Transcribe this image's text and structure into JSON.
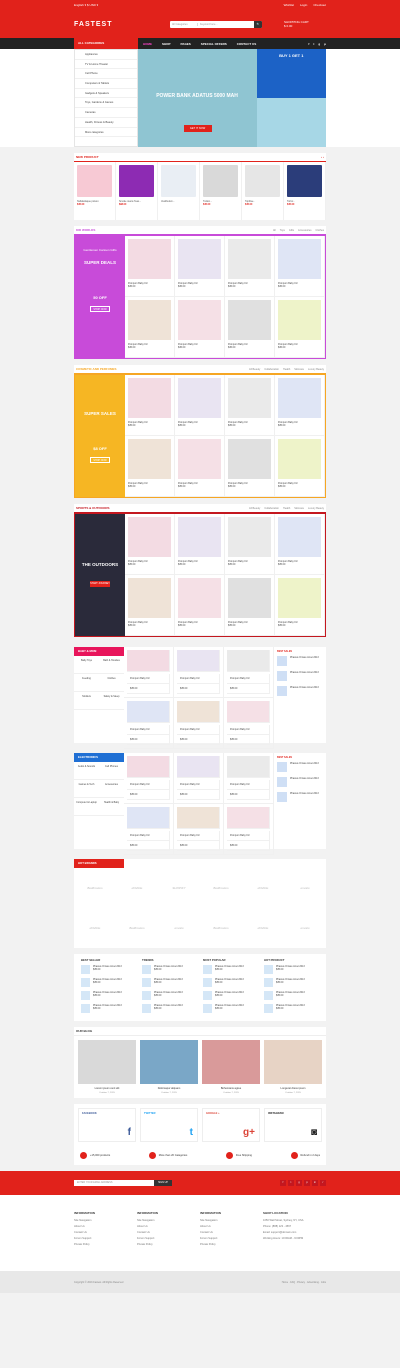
{
  "top": {
    "left": "English ▾  $ USD ▾",
    "wishlist": "Wishlist",
    "login": "Login",
    "checkout": "Checkout"
  },
  "header": {
    "logo": "FASTEST",
    "search_cat": "All Categories",
    "search_ph": "Keyword here...",
    "search_btn": "🔍",
    "cart": "SHOPPING CART",
    "cart_val": "$ 0.00"
  },
  "nav": {
    "allcat": "ALL CATEGORIES",
    "items": [
      "HOME",
      "SHOP",
      "PAGES",
      "SPECIAL OFFERS",
      "CONTACT US"
    ]
  },
  "cats": [
    "Appliances",
    "TV & Home Theater",
    "Cell Phone",
    "Computers & Tablets",
    "Gadgets & Speakers",
    "Toys, Gardens & Games",
    "Cameras",
    "Health, Fitness & Beauty",
    "More categories"
  ],
  "slider": {
    "title": "POWER BANK ADATUS 5000 MAH",
    "btn": "GET IT NOW"
  },
  "sidebanner": {
    "title": "BUY 1 GET 1"
  },
  "newprod": {
    "title": "NEW PRODUCT",
    "items": [
      {
        "name": "Nullafeilaque poison",
        "price": "$45.00"
      },
      {
        "name": "Smoke Jeans Teas...",
        "price": "$98.00"
      },
      {
        "name": "Vestibulum...",
        "price": ""
      },
      {
        "name": "Tuition...",
        "price": "$45.00"
      },
      {
        "name": "Topblue..",
        "price": "$45.00"
      },
      {
        "name": "Tortor...",
        "price": "$45.00"
      }
    ]
  },
  "kids": {
    "title": "KID WORLDS",
    "tabs": [
      "All",
      "Toys",
      "Gifts",
      "Accessories",
      "Clothes"
    ],
    "promo_small": "Gentlemen Cartoon Gifts",
    "promo_big": "SUPER DEALS",
    "promo_off": "50 OFF",
    "promo_btn": "SHOP NOW",
    "items": [
      {
        "name": "Pompom Baby Kiz",
        "price": "$45.00"
      },
      {
        "name": "Pompom Baby Kiz",
        "price": "$45.00"
      },
      {
        "name": "Pompom Baby Kiz",
        "price": "$45.00"
      },
      {
        "name": "Pompom Baby Kiz",
        "price": "$45.00"
      },
      {
        "name": "Pompom Baby Kiz",
        "price": "$45.00"
      },
      {
        "name": "Pompom Baby Kiz",
        "price": "$45.00"
      },
      {
        "name": "Pompom Baby Kiz",
        "price": "$45.00"
      },
      {
        "name": "Pompom Baby Kiz",
        "price": "$45.00"
      }
    ]
  },
  "cosmetic": {
    "title": "COSMETIC AND PERFUMES",
    "tabs": [
      "All Beauty",
      "Collaboration",
      "Health",
      "Skincare",
      "Luxury Beauty"
    ],
    "promo_big": "SUPER SALES",
    "promo_off": "$8 OFF",
    "promo_btn": "SHOP NOW",
    "items": [
      {
        "name": "Pompom Baby Kiz",
        "price": "$35.00"
      },
      {
        "name": "Pompom Baby Kiz",
        "price": "$35.00"
      },
      {
        "name": "Pompom Baby Kiz",
        "price": "$35.00"
      },
      {
        "name": "Pompom Baby Kiz",
        "price": "$35.00"
      },
      {
        "name": "Pompom Baby Kiz",
        "price": "$35.00"
      },
      {
        "name": "Pompom Baby Kiz",
        "price": "$35.00"
      },
      {
        "name": "Pompom Baby Kiz",
        "price": "$35.00"
      },
      {
        "name": "Pompom Baby Kiz",
        "price": "$35.00"
      }
    ]
  },
  "sports": {
    "title": "SPORTS & OUTDOORS",
    "tabs": [
      "All Beauty",
      "Collaboration",
      "Health",
      "Skincare",
      "Luxury Beauty"
    ],
    "promo_big": "THE OUTDOORS",
    "promo_btn": "START JOURNEY",
    "items": [
      {
        "name": "Pompom Baby Kiz",
        "price": "$35.00"
      },
      {
        "name": "Pompom Baby Kiz",
        "price": "$35.00"
      },
      {
        "name": "Pompom Baby Kiz",
        "price": "$35.00"
      },
      {
        "name": "Pompom Baby Kiz",
        "price": "$35.00"
      },
      {
        "name": "Pompom Baby Kiz",
        "price": "$35.00"
      },
      {
        "name": "Pompom Baby Kiz",
        "price": "$35.00"
      },
      {
        "name": "Pompom Baby Kiz",
        "price": "$35.00"
      },
      {
        "name": "Pompom Baby Kiz",
        "price": "$35.00"
      }
    ]
  },
  "baby": {
    "title": "BABY & MOM",
    "cats": [
      "Baby Toys",
      "Bath & Hoodies",
      "Feeding",
      "Clothes",
      "Strollers",
      "Safety & Sleep"
    ],
    "best": "BEST SALES",
    "items": [
      "Pompom Baby Kiz",
      "Pompom Baby Kiz",
      "Pompom Baby Kiz",
      "Pompom Baby Kiz",
      "Pompom Baby Kiz",
      "Pompom Baby Kiz"
    ],
    "price": "$35.00",
    "bestitems": [
      "Phasius Ornare Amet 2013",
      "Phasius Ornare Amet 2013",
      "Phasius Ornare Amet 2013"
    ]
  },
  "electronics": {
    "title": "ELECTRONICS",
    "cats": [
      "Audio & Sounds",
      "Cell Phones",
      "Games & Tech",
      "Accessories",
      "Computer & Laptop",
      "Health & Baby"
    ],
    "best": "BEST SALES",
    "items": [
      "Pompom Baby Kiz",
      "Pompom Baby Kiz",
      "Pompom Baby Kiz",
      "Pompom Baby Kiz",
      "Pompom Baby Kiz",
      "Pompom Baby Kiz"
    ],
    "price": "$35.00",
    "bestitems": [
      "Phasius Ornare Amet 2013",
      "Phasius Ornare Amet 2013",
      "Phasius Ornare Amet 2013"
    ]
  },
  "brands": {
    "title": "HOT BRANDS",
    "items": [
      "Bedfrosters",
      "dribbble",
      "SHOPIFY",
      "Bedfrosters",
      "dribbble",
      "envato",
      "dribbble",
      "Bedfrosters",
      "envato",
      "Bedfrosters",
      "dribbble",
      "envato"
    ]
  },
  "lists": {
    "cols": [
      {
        "h": "BEST SELLER"
      },
      {
        "h": "TRENDS"
      },
      {
        "h": "MOST POPULAR"
      },
      {
        "h": "HOT PRODUCT"
      }
    ],
    "item": "Phasius Ornare Amet 2013",
    "price": "$35.00"
  },
  "blog": {
    "title": "OUR BLOG",
    "posts": [
      {
        "t": "Lorem ipsum ount elit",
        "d": "October 7, 2015"
      },
      {
        "t": "Dolorsapur aliquam",
        "d": "October 7, 2015"
      },
      {
        "t": "Bohemians agree",
        "d": "October 7, 2015"
      },
      {
        "t": "Longerat dress ipsum",
        "d": "October 7, 2015"
      }
    ]
  },
  "social": [
    {
      "t": "FACEBOOK",
      "i": "f"
    },
    {
      "t": "TWITTER",
      "i": "t"
    },
    {
      "t": "GOOGLE +",
      "i": "g+"
    },
    {
      "t": "INSTAGRAM",
      "i": "◙"
    }
  ],
  "features": [
    "+15,000 products",
    "More than 20 Categories",
    "Free Shipping",
    "Refund in 2 days"
  ],
  "newsletter": {
    "ph": "ENTER YOUR EMAIL ADDRESS",
    "btn": "SIGN UP",
    "soc": [
      "f",
      "t",
      "g",
      "p",
      "in",
      "r"
    ]
  },
  "footer": [
    {
      "h": "INFORMATION",
      "items": [
        "Site Navigation",
        "About Us",
        "Contact Us",
        "Forum Support",
        "Private Policy"
      ]
    },
    {
      "h": "INFORMATION",
      "items": [
        "Site Navigation",
        "About Us",
        "Contact Us",
        "Forum Support",
        "Private Policy"
      ]
    },
    {
      "h": "INFORMATION",
      "items": [
        "Site Navigation",
        "About Us",
        "Contact Us",
        "Forum Support",
        "Private Policy"
      ]
    },
    {
      "h": "SHOP LOCATION",
      "items": [
        "1050 Wall Street, Sydney, NY, USA",
        "Phone: (888) 123 - 4567",
        "Email: support@domain.com",
        "Working Hours: 10:00AM - 9:00PM"
      ]
    }
  ],
  "copy": {
    "left": "Copyright © 2016 Fastest. All Rights Reserved",
    "links": "Home · FAQ · Privacy · Advertising · Jobs"
  }
}
